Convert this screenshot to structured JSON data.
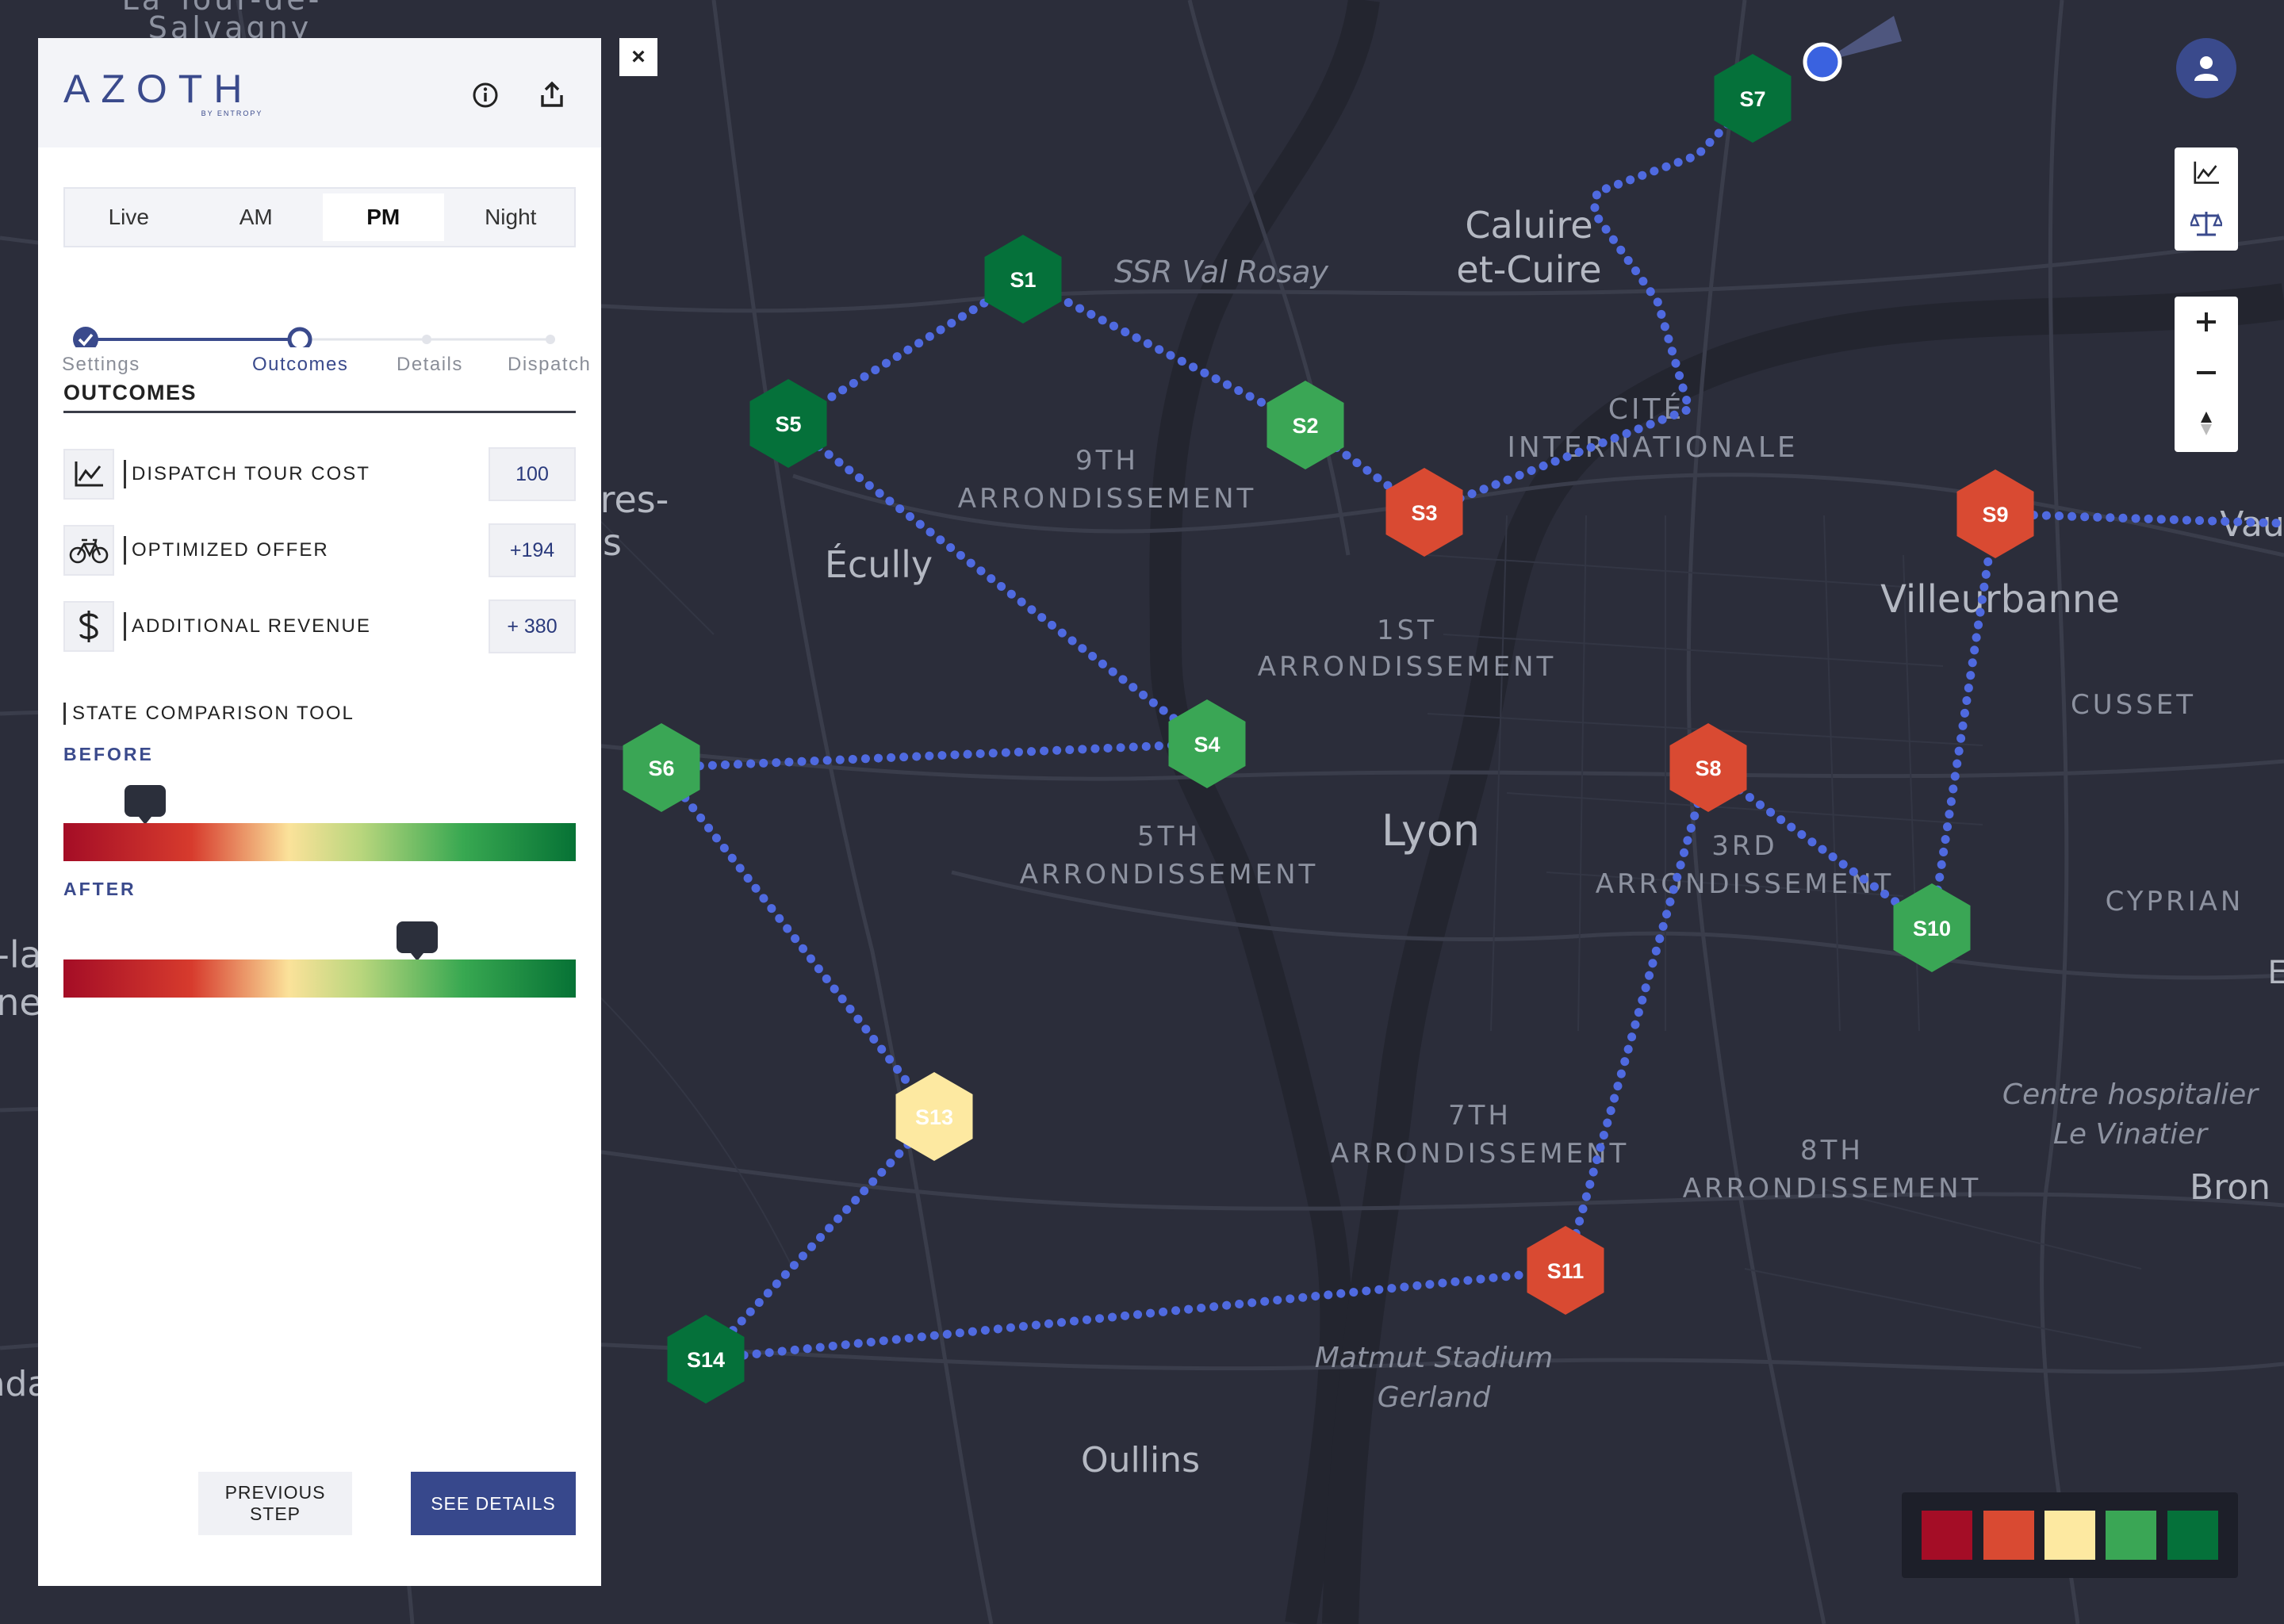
{
  "app": {
    "logo_text": "AZOTH",
    "logo_sub": "BY ENTROPY"
  },
  "header": {
    "info_icon": "info-icon",
    "share_icon": "share-icon"
  },
  "close_label": "×",
  "tabs": [
    {
      "label": "Live",
      "active": false
    },
    {
      "label": "AM",
      "active": false
    },
    {
      "label": "PM",
      "active": true
    },
    {
      "label": "Night",
      "active": false
    }
  ],
  "stepper": {
    "steps": [
      {
        "label": "Settings",
        "state": "done"
      },
      {
        "label": "Outcomes",
        "state": "current"
      },
      {
        "label": "Details",
        "state": "todo"
      },
      {
        "label": "Dispatch",
        "state": "todo"
      }
    ]
  },
  "outcomes": {
    "title": "OUTCOMES",
    "metrics": [
      {
        "icon": "line-chart-icon",
        "label": "DISPATCH TOUR COST",
        "value": "100"
      },
      {
        "icon": "bicycle-icon",
        "label": "OPTIMIZED OFFER",
        "value": "+194"
      },
      {
        "icon": "dollar-icon",
        "label": "ADDITIONAL REVENUE",
        "value": "+ 380"
      }
    ]
  },
  "comparison": {
    "title": "STATE COMPARISON TOOL",
    "before": {
      "label": "BEFORE",
      "position": 0.16
    },
    "after": {
      "label": "AFTER",
      "position": 0.69
    }
  },
  "buttons": {
    "previous": "PREVIOUS STEP",
    "details": "SEE DETAILS"
  },
  "status_colors": [
    "#a40d26",
    "#d94a32",
    "#fde9a1",
    "#3aa655",
    "#05713a"
  ],
  "map": {
    "places": [
      {
        "text": "Caluire",
        "cls": "big"
      },
      {
        "text": "et-Cuire",
        "cls": "big"
      },
      {
        "text": "SSR Val Rosay",
        "cls": "i"
      },
      {
        "text": "CITÉ",
        "cls": "n"
      },
      {
        "text": "INTERNATIONALE",
        "cls": "n"
      },
      {
        "text": "9TH",
        "cls": "n"
      },
      {
        "text": "ARRONDISSEMENT",
        "cls": "n"
      },
      {
        "text": "Écully",
        "cls": "big"
      },
      {
        "text": "1ST",
        "cls": "n"
      },
      {
        "text": "ARRONDISSEMENT",
        "cls": "n"
      },
      {
        "text": "Villeurbanne",
        "cls": "big"
      },
      {
        "text": "CUSSET",
        "cls": "n"
      },
      {
        "text": "Lyon",
        "cls": "big"
      },
      {
        "text": "5TH",
        "cls": "n"
      },
      {
        "text": "ARRONDISSEMENT",
        "cls": "n"
      },
      {
        "text": "3RD",
        "cls": "n"
      },
      {
        "text": "ARRONDISSEMENT",
        "cls": "n"
      },
      {
        "text": "CYPRIAN",
        "cls": "n"
      },
      {
        "text": "7TH",
        "cls": "n"
      },
      {
        "text": "ARRONDISSEMENT",
        "cls": "n"
      },
      {
        "text": "8TH",
        "cls": "n"
      },
      {
        "text": "ARRONDISSEMENT",
        "cls": "n"
      },
      {
        "text": "Centre hospitalier",
        "cls": "i"
      },
      {
        "text": "Le Vinatier",
        "cls": "i"
      },
      {
        "text": "Bron",
        "cls": "big"
      },
      {
        "text": "Matmut Stadium",
        "cls": "i"
      },
      {
        "text": "Gerland",
        "cls": "i"
      },
      {
        "text": "Oullins",
        "cls": "big"
      },
      {
        "text": "La Tour-de-",
        "cls": "n"
      },
      {
        "text": "Salvagny",
        "cls": "n"
      },
      {
        "text": "res-",
        "cls": "big"
      },
      {
        "text": "s",
        "cls": "big"
      },
      {
        "text": "-la",
        "cls": "big"
      },
      {
        "text": "ne",
        "cls": "big"
      },
      {
        "text": "Vau",
        "cls": "big"
      },
      {
        "text": "nda",
        "cls": "big"
      },
      {
        "text": "E",
        "cls": "big"
      }
    ],
    "stations": [
      {
        "label": "S1",
        "status": 4
      },
      {
        "label": "S2",
        "status": 3
      },
      {
        "label": "S3",
        "status": 1
      },
      {
        "label": "S4",
        "status": 3
      },
      {
        "label": "S5",
        "status": 4
      },
      {
        "label": "S6",
        "status": 3
      },
      {
        "label": "S7",
        "status": 4
      },
      {
        "label": "S8",
        "status": 1
      },
      {
        "label": "S9",
        "status": 1
      },
      {
        "label": "S10",
        "status": 3
      },
      {
        "label": "S11",
        "status": 1
      },
      {
        "label": "S13",
        "status": 2
      },
      {
        "label": "S14",
        "status": 4
      }
    ]
  }
}
